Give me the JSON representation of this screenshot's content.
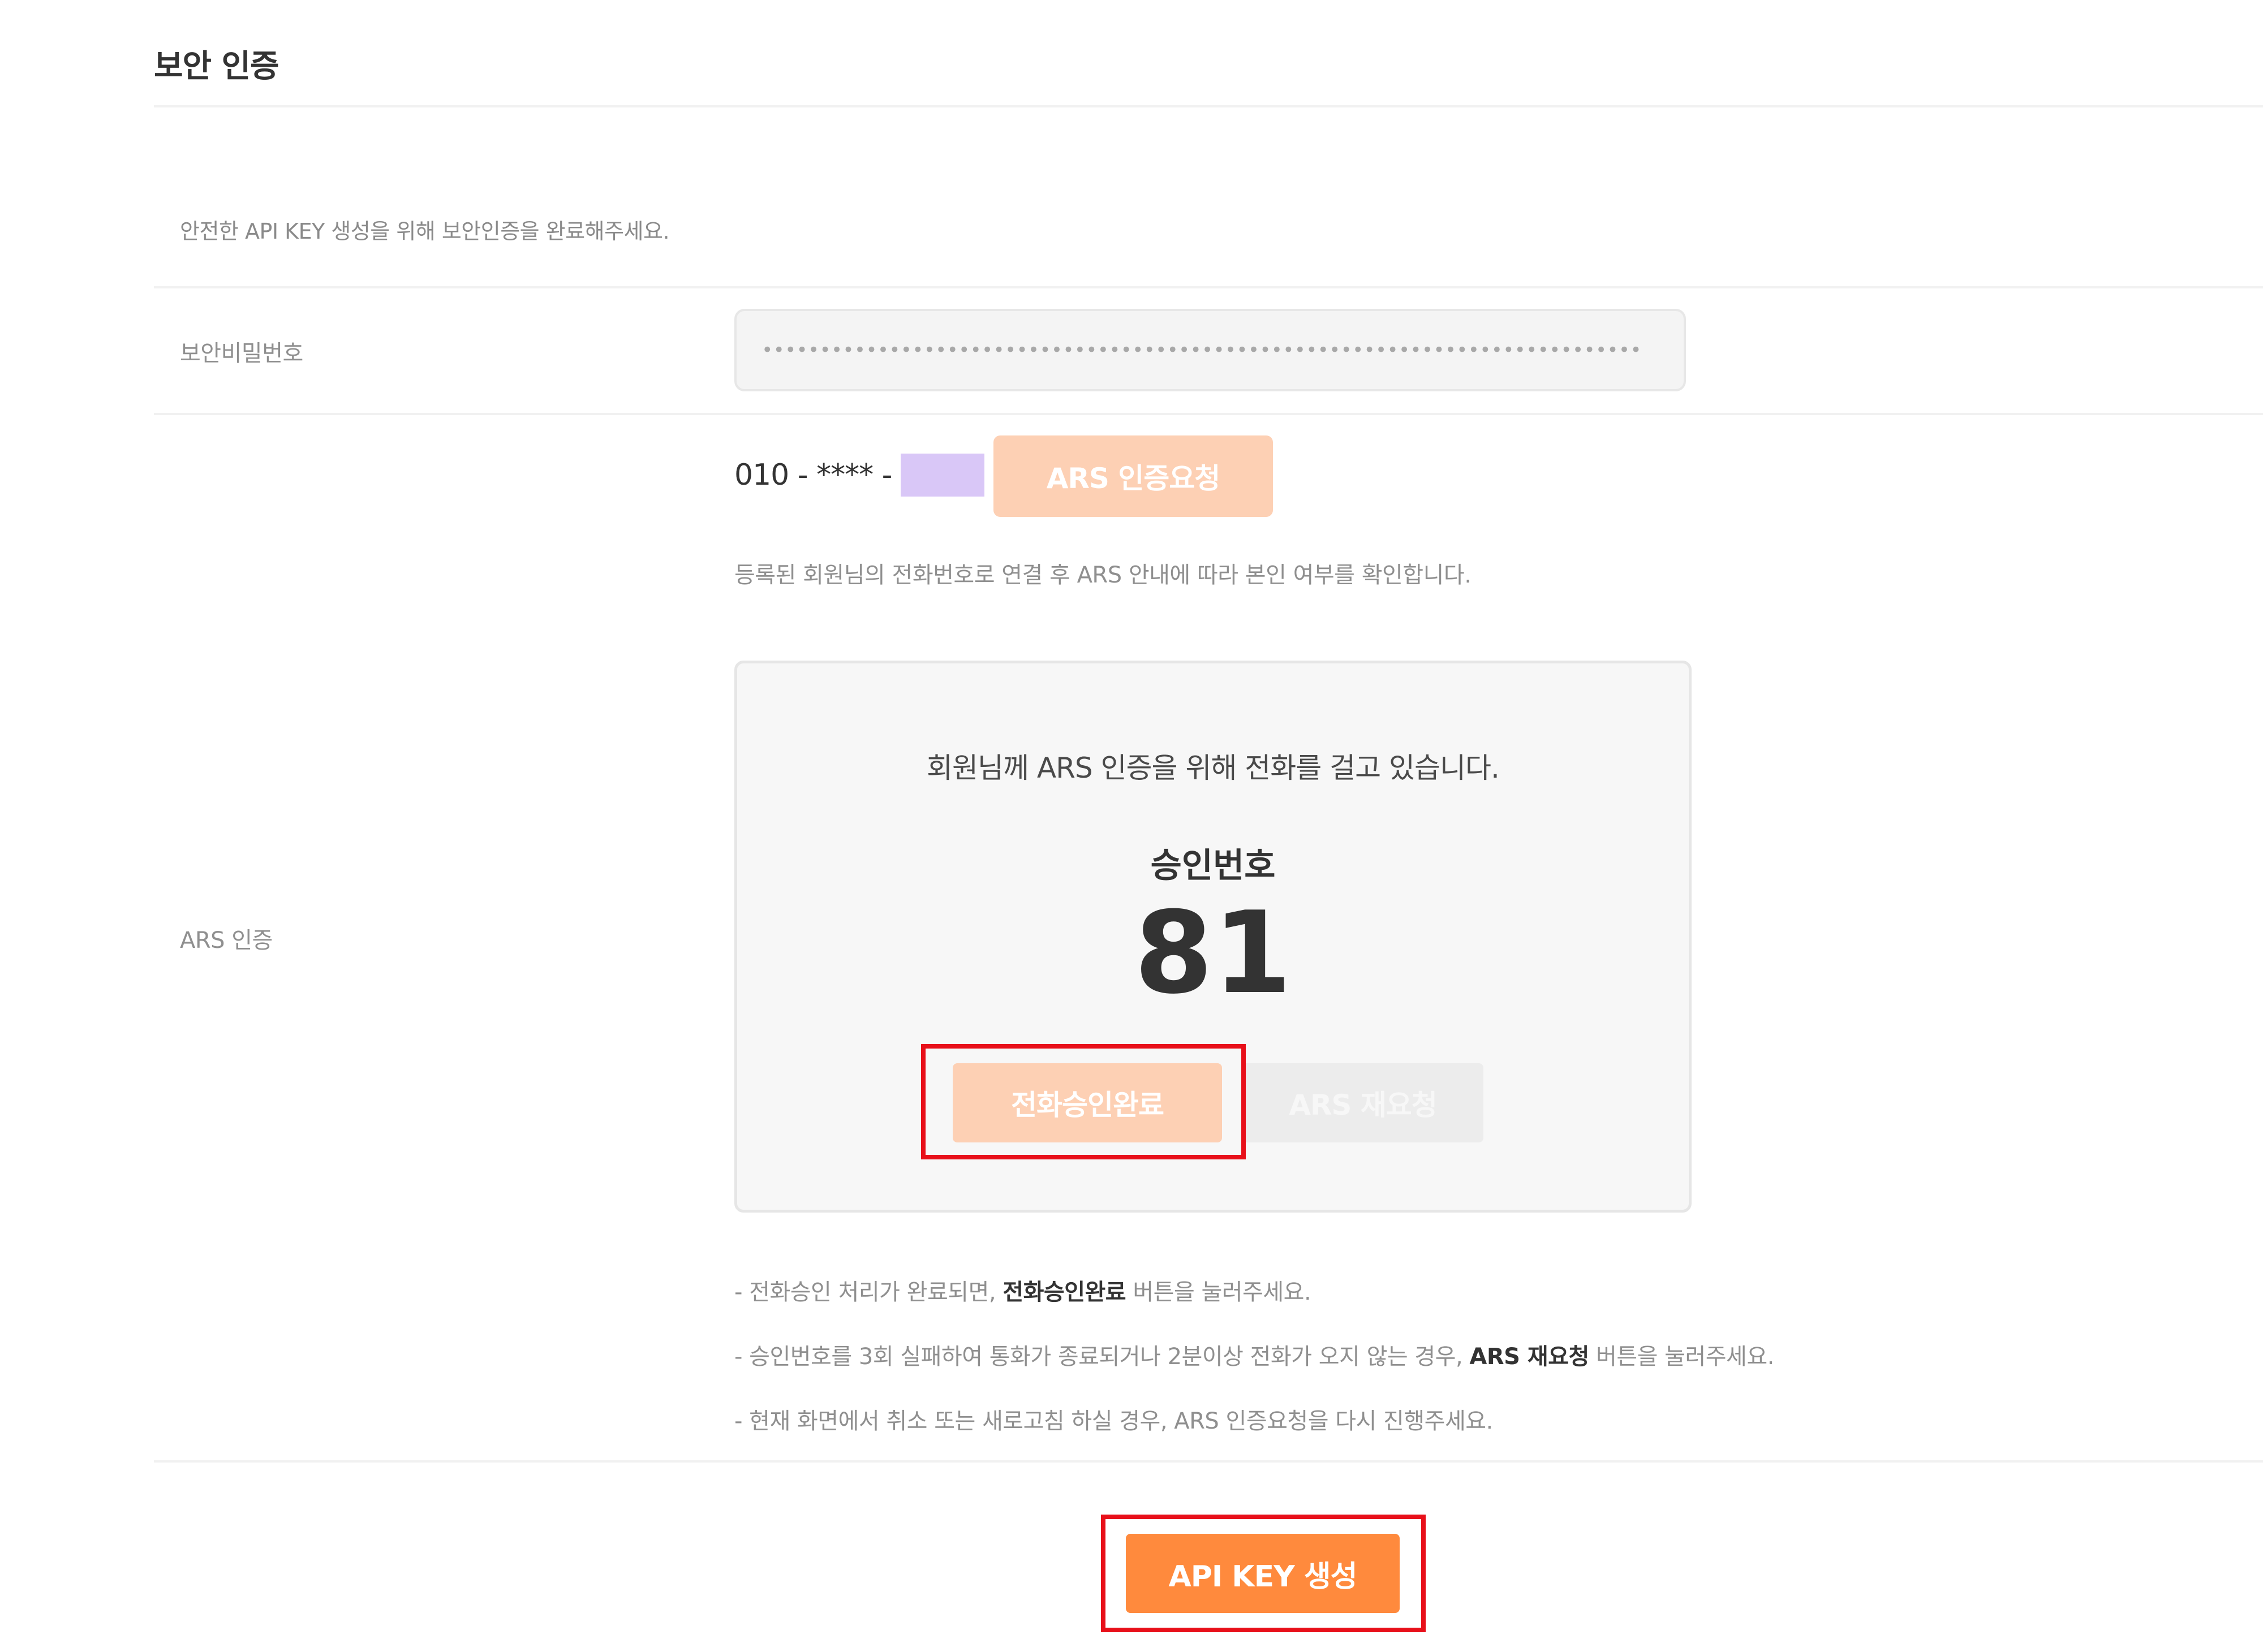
{
  "section": {
    "title": "보안 인증",
    "intro": "안전한 API KEY 생성을 위해 보안인증을 완료해주세요."
  },
  "security_password": {
    "label": "보안비밀번호",
    "value": "••••••••••••••••••••••••••••••••••••••••••••••••••••••••••••••••••••••••••••"
  },
  "ars": {
    "label": "ARS 인증",
    "phone_prefix": "010 - **** -",
    "request_button": "ARS 인증요청",
    "description": "등록된 회원님의 전화번호로 연결 후 ARS 안내에 따라 본인 여부를 확인합니다.",
    "calling_message": "회원님께 ARS 인증을 위해 전화를 걸고 있습니다.",
    "approval_title": "승인번호",
    "approval_number": "81",
    "call_complete_button": "전화승인완료",
    "retry_button": "ARS 재요청"
  },
  "notes": {
    "note1_pre": "- 전화승인 처리가 완료되면, ",
    "note1_bold": "전화승인완료",
    "note1_post": " 버튼을 눌러주세요.",
    "note2_pre": "- 승인번호를 3회 실패하여 통화가 종료되거나 2분이상 전화가 오지 않는 경우, ",
    "note2_bold": "ARS 재요청",
    "note2_post": " 버튼을 눌러주세요.",
    "note3": "- 현재 화면에서 취소 또는 새로고침 하실 경우, ARS 인증요청을 다시 진행주세요."
  },
  "submit": {
    "label": "API KEY 생성"
  },
  "colors": {
    "accent": "#ff8a3d",
    "accent_disabled": "#fdd0b4",
    "highlight": "#e8101a",
    "masked": "#d9c7f7"
  }
}
